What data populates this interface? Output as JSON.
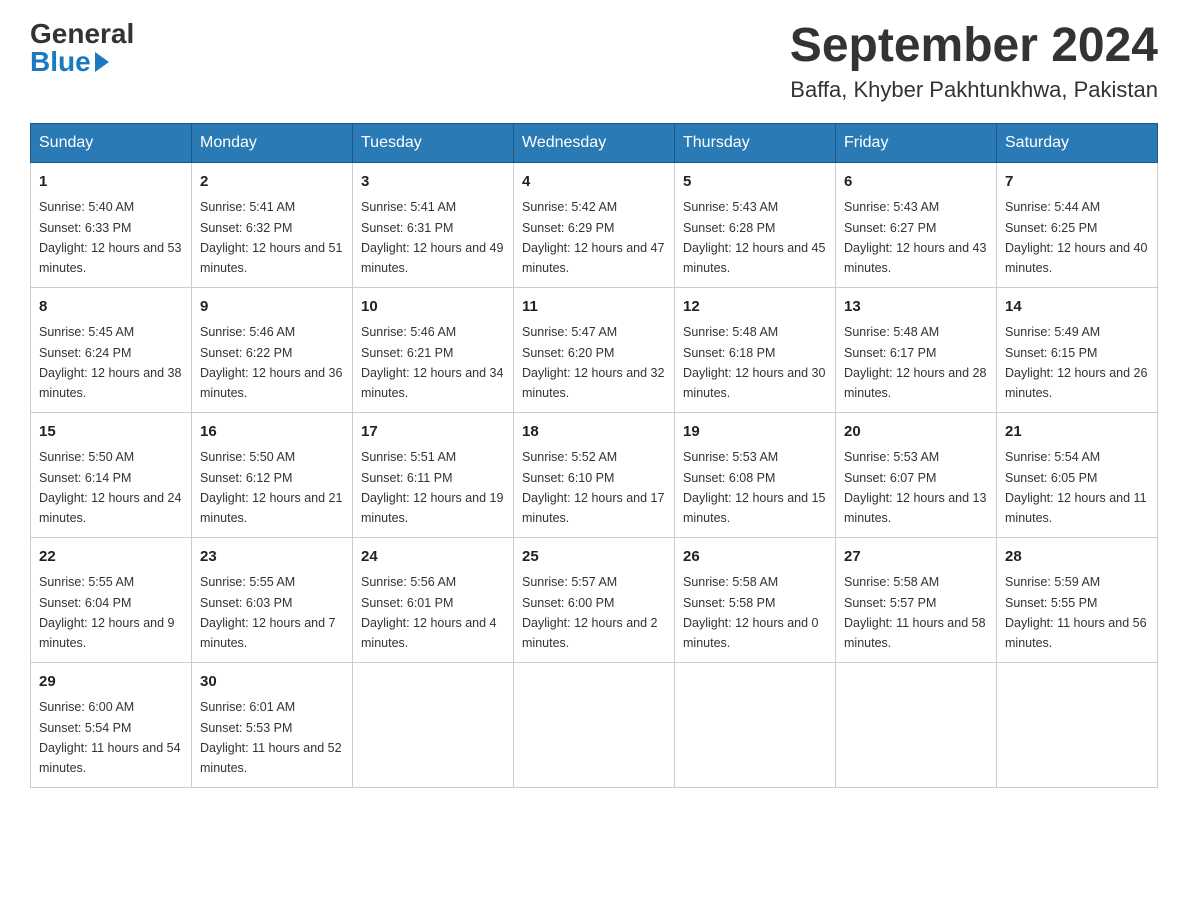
{
  "logo": {
    "general": "General",
    "blue": "Blue"
  },
  "header": {
    "month": "September 2024",
    "location": "Baffa, Khyber Pakhtunkhwa, Pakistan"
  },
  "weekdays": [
    "Sunday",
    "Monday",
    "Tuesday",
    "Wednesday",
    "Thursday",
    "Friday",
    "Saturday"
  ],
  "weeks": [
    [
      {
        "day": "1",
        "sunrise": "5:40 AM",
        "sunset": "6:33 PM",
        "daylight": "12 hours and 53 minutes."
      },
      {
        "day": "2",
        "sunrise": "5:41 AM",
        "sunset": "6:32 PM",
        "daylight": "12 hours and 51 minutes."
      },
      {
        "day": "3",
        "sunrise": "5:41 AM",
        "sunset": "6:31 PM",
        "daylight": "12 hours and 49 minutes."
      },
      {
        "day": "4",
        "sunrise": "5:42 AM",
        "sunset": "6:29 PM",
        "daylight": "12 hours and 47 minutes."
      },
      {
        "day": "5",
        "sunrise": "5:43 AM",
        "sunset": "6:28 PM",
        "daylight": "12 hours and 45 minutes."
      },
      {
        "day": "6",
        "sunrise": "5:43 AM",
        "sunset": "6:27 PM",
        "daylight": "12 hours and 43 minutes."
      },
      {
        "day": "7",
        "sunrise": "5:44 AM",
        "sunset": "6:25 PM",
        "daylight": "12 hours and 40 minutes."
      }
    ],
    [
      {
        "day": "8",
        "sunrise": "5:45 AM",
        "sunset": "6:24 PM",
        "daylight": "12 hours and 38 minutes."
      },
      {
        "day": "9",
        "sunrise": "5:46 AM",
        "sunset": "6:22 PM",
        "daylight": "12 hours and 36 minutes."
      },
      {
        "day": "10",
        "sunrise": "5:46 AM",
        "sunset": "6:21 PM",
        "daylight": "12 hours and 34 minutes."
      },
      {
        "day": "11",
        "sunrise": "5:47 AM",
        "sunset": "6:20 PM",
        "daylight": "12 hours and 32 minutes."
      },
      {
        "day": "12",
        "sunrise": "5:48 AM",
        "sunset": "6:18 PM",
        "daylight": "12 hours and 30 minutes."
      },
      {
        "day": "13",
        "sunrise": "5:48 AM",
        "sunset": "6:17 PM",
        "daylight": "12 hours and 28 minutes."
      },
      {
        "day": "14",
        "sunrise": "5:49 AM",
        "sunset": "6:15 PM",
        "daylight": "12 hours and 26 minutes."
      }
    ],
    [
      {
        "day": "15",
        "sunrise": "5:50 AM",
        "sunset": "6:14 PM",
        "daylight": "12 hours and 24 minutes."
      },
      {
        "day": "16",
        "sunrise": "5:50 AM",
        "sunset": "6:12 PM",
        "daylight": "12 hours and 21 minutes."
      },
      {
        "day": "17",
        "sunrise": "5:51 AM",
        "sunset": "6:11 PM",
        "daylight": "12 hours and 19 minutes."
      },
      {
        "day": "18",
        "sunrise": "5:52 AM",
        "sunset": "6:10 PM",
        "daylight": "12 hours and 17 minutes."
      },
      {
        "day": "19",
        "sunrise": "5:53 AM",
        "sunset": "6:08 PM",
        "daylight": "12 hours and 15 minutes."
      },
      {
        "day": "20",
        "sunrise": "5:53 AM",
        "sunset": "6:07 PM",
        "daylight": "12 hours and 13 minutes."
      },
      {
        "day": "21",
        "sunrise": "5:54 AM",
        "sunset": "6:05 PM",
        "daylight": "12 hours and 11 minutes."
      }
    ],
    [
      {
        "day": "22",
        "sunrise": "5:55 AM",
        "sunset": "6:04 PM",
        "daylight": "12 hours and 9 minutes."
      },
      {
        "day": "23",
        "sunrise": "5:55 AM",
        "sunset": "6:03 PM",
        "daylight": "12 hours and 7 minutes."
      },
      {
        "day": "24",
        "sunrise": "5:56 AM",
        "sunset": "6:01 PM",
        "daylight": "12 hours and 4 minutes."
      },
      {
        "day": "25",
        "sunrise": "5:57 AM",
        "sunset": "6:00 PM",
        "daylight": "12 hours and 2 minutes."
      },
      {
        "day": "26",
        "sunrise": "5:58 AM",
        "sunset": "5:58 PM",
        "daylight": "12 hours and 0 minutes."
      },
      {
        "day": "27",
        "sunrise": "5:58 AM",
        "sunset": "5:57 PM",
        "daylight": "11 hours and 58 minutes."
      },
      {
        "day": "28",
        "sunrise": "5:59 AM",
        "sunset": "5:55 PM",
        "daylight": "11 hours and 56 minutes."
      }
    ],
    [
      {
        "day": "29",
        "sunrise": "6:00 AM",
        "sunset": "5:54 PM",
        "daylight": "11 hours and 54 minutes."
      },
      {
        "day": "30",
        "sunrise": "6:01 AM",
        "sunset": "5:53 PM",
        "daylight": "11 hours and 52 minutes."
      },
      null,
      null,
      null,
      null,
      null
    ]
  ]
}
